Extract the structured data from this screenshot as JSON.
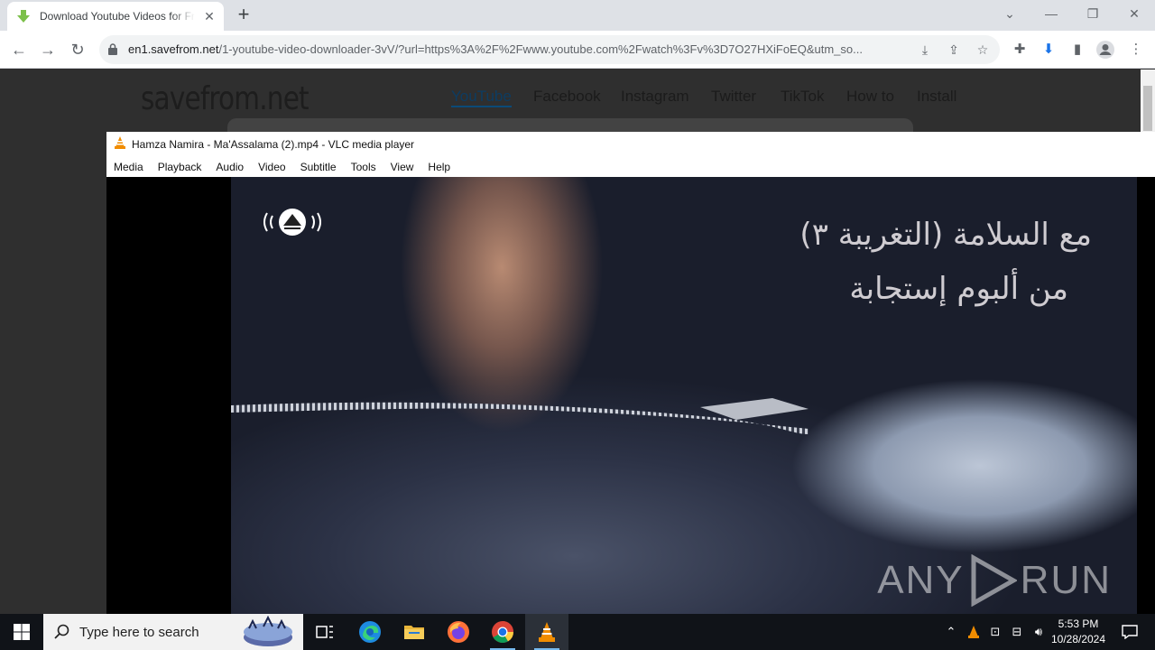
{
  "browser": {
    "tab_title": "Download Youtube Videos for Free",
    "new_tab_label": "+",
    "url_host": "en1.savefrom.net",
    "url_path": "/1-youtube-video-downloader-3vV/?url=https%3A%2F%2Fwww.youtube.com%2Fwatch%3Fv%3D7O27HXiFoEQ&utm_so..."
  },
  "site": {
    "logo": "savefrom.net",
    "nav": [
      "YouTube",
      "Facebook",
      "Instagram",
      "Twitter",
      "TikTok",
      "How to",
      "Install"
    ]
  },
  "vlc": {
    "title": "Hamza Namira - Ma'Assalama  (2).mp4 - VLC media player",
    "menu": [
      "Media",
      "Playback",
      "Audio",
      "Video",
      "Subtitle",
      "Tools",
      "View",
      "Help"
    ],
    "video_text_line1": "مع السلامة (التغريبة ٣)",
    "video_text_line2": "من ألبوم إستجابة",
    "watermark": [
      "ANY",
      "RUN"
    ]
  },
  "taskbar": {
    "search_placeholder": "Type here to search",
    "time": "5:53 PM",
    "date": "10/28/2024"
  },
  "colors": {
    "chrome_tabstrip": "#dee1e6",
    "page_bg": "#2f2f2f",
    "taskbar_bg": "#101318",
    "vlc_orange": "#f08c00"
  }
}
